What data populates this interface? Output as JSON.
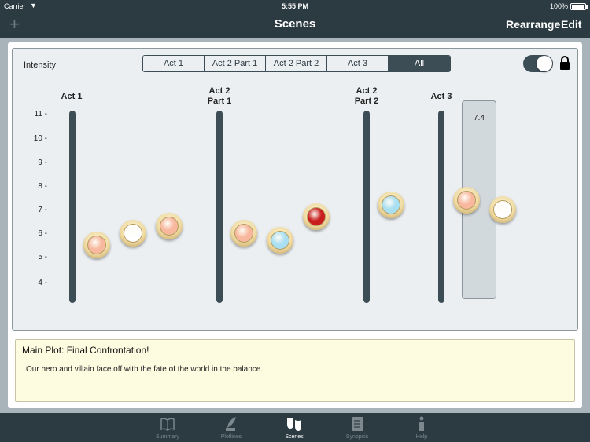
{
  "status": {
    "carrier": "Carrier",
    "time": "5:55 PM",
    "battery": "100%"
  },
  "nav": {
    "title": "Scenes",
    "rearrange": "Rearrange",
    "edit": "Edit"
  },
  "graph": {
    "intensity_label": "Intensity",
    "segments": [
      {
        "label": "Act 1",
        "selected": false
      },
      {
        "label": "Act 2 Part 1",
        "selected": false
      },
      {
        "label": "Act 2 Part 2",
        "selected": false
      },
      {
        "label": "Act 3",
        "selected": false
      },
      {
        "label": "All",
        "selected": true
      }
    ],
    "lock_enabled": true,
    "y_ticks": [
      "11 -",
      "10 -",
      "9 -",
      "8 -",
      "7 -",
      "6 -",
      "5 -",
      "4 -"
    ],
    "acts": [
      {
        "label_lines": [
          "Act 1"
        ]
      },
      {
        "label_lines": [
          "Act 2",
          "Part 1"
        ]
      },
      {
        "label_lines": [
          "Act 2",
          "Part 2"
        ]
      },
      {
        "label_lines": [
          "Act 3"
        ]
      }
    ],
    "selected_value": "7.4",
    "scenes": [
      {
        "intensity": 5.5,
        "color": "#f7b89e"
      },
      {
        "intensity": 6.0,
        "color": "#ffffff"
      },
      {
        "intensity": 6.3,
        "color": "#f7b89e"
      },
      {
        "intensity": 6.0,
        "color": "#f7b89e"
      },
      {
        "intensity": 5.7,
        "color": "#a9dff2"
      },
      {
        "intensity": 6.7,
        "color": "#c81e1e"
      },
      {
        "intensity": 7.2,
        "color": "#a9dff2"
      },
      {
        "intensity": 7.4,
        "color": "#f7b89e"
      },
      {
        "intensity": 7.0,
        "color": "#ffffff"
      }
    ]
  },
  "synopsis": {
    "title": "Main Plot: Final Confrontation!",
    "text": "Our hero and villain face off with the fate of the world in the balance."
  },
  "tabs": [
    {
      "label": "Summary",
      "active": false
    },
    {
      "label": "Plotlines",
      "active": false
    },
    {
      "label": "Scenes",
      "active": true
    },
    {
      "label": "Synopsis",
      "active": false
    },
    {
      "label": "Help",
      "active": false
    }
  ]
}
